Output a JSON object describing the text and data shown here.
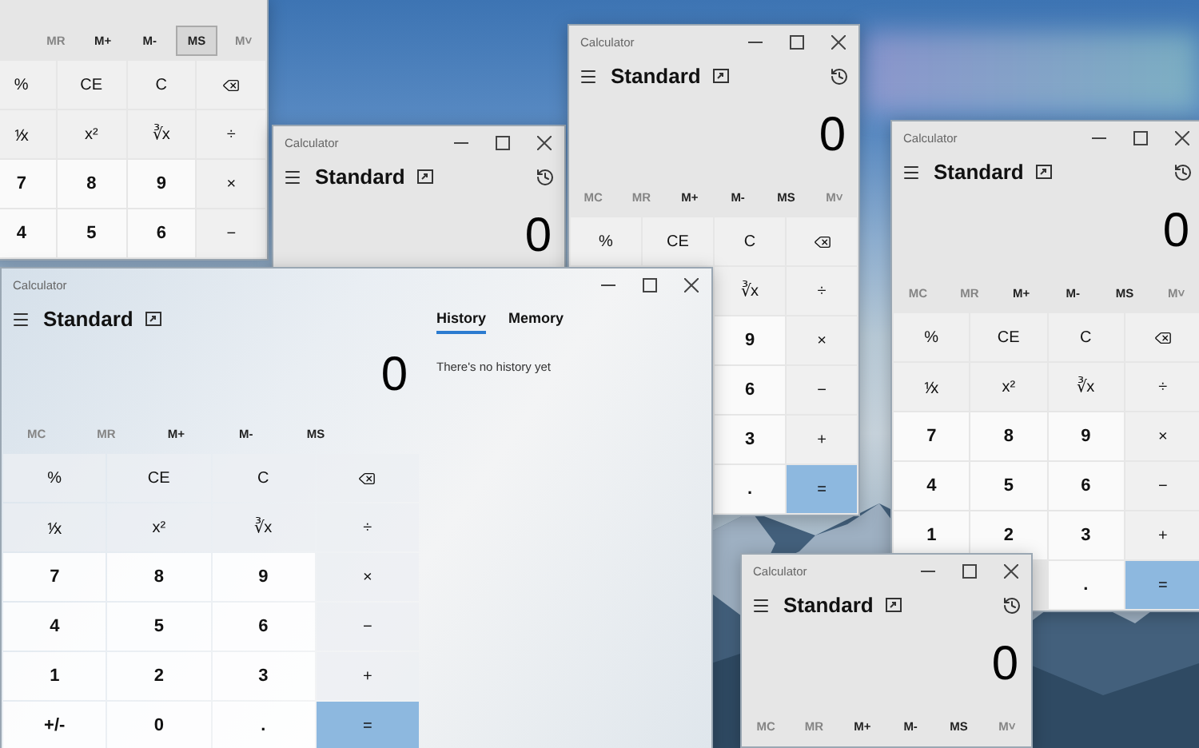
{
  "windows": [
    {
      "memory": [
        {
          "label": "MR",
          "disabled": true,
          "hovered": false
        },
        {
          "label": "M+",
          "disabled": false,
          "hovered": false
        },
        {
          "label": "M-",
          "disabled": false,
          "hovered": false
        },
        {
          "label": "MS",
          "disabled": false,
          "hovered": true
        },
        {
          "label": "M˅",
          "disabled": true,
          "hovered": false
        }
      ],
      "keys": [
        [
          "%",
          "CE",
          "C",
          {
            "kind": "backspace"
          }
        ],
        [
          "⅟x",
          "x²",
          "∛x",
          "÷"
        ],
        [
          "7",
          "8",
          "9",
          "×"
        ],
        [
          "4",
          "5",
          "6",
          "−"
        ]
      ]
    },
    {
      "title": "Calculator",
      "mode": "Standard",
      "history_button": true,
      "display": "0"
    },
    {
      "title": "Calculator",
      "mode": "Standard",
      "history_button": true,
      "display": "0",
      "memory": [
        {
          "label": "MC",
          "disabled": true,
          "hovered": false
        },
        {
          "label": "MR",
          "disabled": true,
          "hovered": false
        },
        {
          "label": "M+",
          "disabled": false,
          "hovered": false
        },
        {
          "label": "M-",
          "disabled": false,
          "hovered": false
        },
        {
          "label": "MS",
          "disabled": false,
          "hovered": false
        },
        {
          "label": "M˅",
          "disabled": true,
          "hovered": false
        }
      ],
      "keys": [
        [
          "%",
          "CE",
          "C",
          {
            "kind": "backspace"
          }
        ],
        [
          "∛x",
          "÷"
        ],
        [
          "9",
          "×"
        ],
        [
          "6",
          "−"
        ],
        [
          "3",
          "+"
        ],
        [
          ".",
          "="
        ]
      ]
    },
    {
      "title": "Calculator",
      "mode": "Standard",
      "history_button": true,
      "display": "0",
      "memory": [
        {
          "label": "MC",
          "disabled": true,
          "hovered": false
        },
        {
          "label": "MR",
          "disabled": true,
          "hovered": false
        },
        {
          "label": "M+",
          "disabled": false,
          "hovered": false
        },
        {
          "label": "M-",
          "disabled": false,
          "hovered": false
        },
        {
          "label": "MS",
          "disabled": false,
          "hovered": false
        },
        {
          "label": "M˅",
          "disabled": true,
          "hovered": false
        }
      ],
      "keys": [
        [
          "%",
          "CE",
          "C",
          {
            "kind": "backspace"
          }
        ],
        [
          "⅟x",
          "x²",
          "∛x",
          "÷"
        ],
        [
          "7",
          "8",
          "9",
          "×"
        ],
        [
          "4",
          "5",
          "6",
          "−"
        ],
        [
          "1",
          "2",
          "3",
          "+"
        ],
        [
          ".",
          "="
        ]
      ]
    },
    {
      "title": "Calculator",
      "mode": "Standard",
      "history_button": false,
      "display": "0",
      "memory": [
        {
          "label": "MC",
          "disabled": true,
          "hovered": false
        },
        {
          "label": "MR",
          "disabled": true,
          "hovered": false
        },
        {
          "label": "M+",
          "disabled": false,
          "hovered": false
        },
        {
          "label": "M-",
          "disabled": false,
          "hovered": false
        },
        {
          "label": "MS",
          "disabled": false,
          "hovered": false
        }
      ],
      "keys": [
        [
          "%",
          "CE",
          "C",
          {
            "kind": "backspace"
          }
        ],
        [
          "⅟x",
          "x²",
          "∛x",
          "÷"
        ],
        [
          "7",
          "8",
          "9",
          "×"
        ],
        [
          "4",
          "5",
          "6",
          "−"
        ],
        [
          "1",
          "2",
          "3",
          "+"
        ],
        [
          "+/-",
          "0",
          ".",
          "="
        ]
      ],
      "side_panel": {
        "tabs": [
          {
            "label": "History",
            "selected": true
          },
          {
            "label": "Memory",
            "selected": false
          }
        ],
        "message": "There's no history yet"
      }
    },
    {
      "title": "Calculator",
      "mode": "Standard",
      "history_button": true,
      "display": "0",
      "memory": [
        {
          "label": "MC",
          "disabled": true,
          "hovered": false
        },
        {
          "label": "MR",
          "disabled": true,
          "hovered": false
        },
        {
          "label": "M+",
          "disabled": false,
          "hovered": false
        },
        {
          "label": "M-",
          "disabled": false,
          "hovered": false
        },
        {
          "label": "MS",
          "disabled": false,
          "hovered": false
        },
        {
          "label": "M˅",
          "disabled": true,
          "hovered": false
        }
      ]
    }
  ]
}
